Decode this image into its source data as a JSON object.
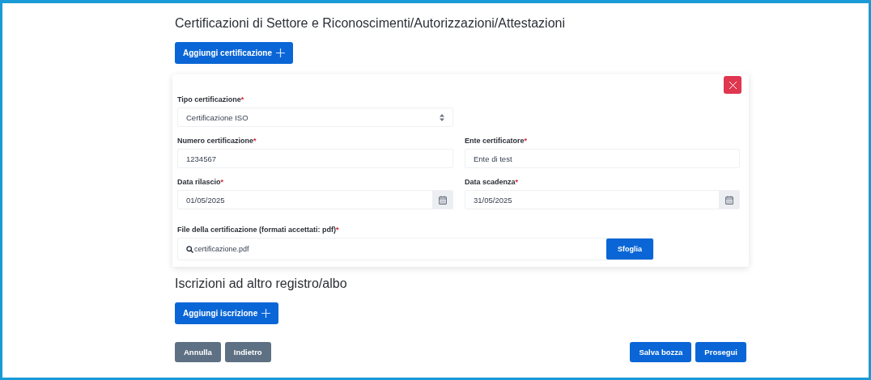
{
  "sections": [
    {
      "title": "Certificazioni di Settore e Riconoscimenti/Autorizzazioni/Attestazioni",
      "add_button": "Aggiungi certificazione",
      "card": {
        "fields": [
          {
            "kind": "select",
            "label": "Tipo certificazione",
            "required_mark": "*",
            "value": "Certificazione ISO"
          },
          {
            "kind": "break"
          },
          {
            "kind": "text",
            "label": "Numero certificazione",
            "required_mark": "*",
            "value": "1234567"
          },
          {
            "kind": "text",
            "label": "Ente certificatore",
            "required_mark": "*",
            "value": "Ente di test"
          },
          {
            "kind": "date",
            "label": "Data rilascio",
            "required_mark": "*",
            "value": "01/05/2025"
          },
          {
            "kind": "date",
            "label": "Data scadenza",
            "required_mark": "*",
            "value": "31/05/2025"
          },
          {
            "kind": "file",
            "label": "File della certificazione (formati accettati: pdf)",
            "required_mark": "*",
            "value": "certificazione.pdf",
            "button": "Sfoglia"
          }
        ]
      }
    },
    {
      "title": "Iscrizioni ad altro registro/albo",
      "add_button": "Aggiungi iscrizione"
    }
  ],
  "footer": {
    "left": [
      "Annulla",
      "Indietro"
    ],
    "right": [
      "Salva bozza",
      "Prosegui"
    ]
  }
}
